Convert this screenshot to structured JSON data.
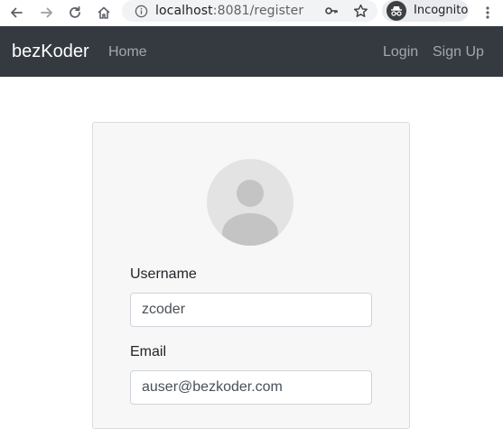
{
  "browser": {
    "url_host": "localhost",
    "url_port_path": ":8081/register",
    "incognito_label": "Incognito"
  },
  "navbar": {
    "brand": "bezKoder",
    "home_label": "Home",
    "login_label": "Login",
    "signup_label": "Sign Up"
  },
  "form": {
    "username_label": "Username",
    "username_value": "zcoder",
    "email_label": "Email",
    "email_value": "auser@bezkoder.com"
  },
  "colors": {
    "navbar_bg": "#343a40",
    "card_bg": "#f7f7f7",
    "avatar_bg": "#e3e3e3",
    "avatar_fg": "#c4c4c4"
  },
  "icons": {
    "back": "arrow-left-icon",
    "forward": "arrow-right-icon",
    "reload": "reload-icon",
    "home": "home-icon",
    "info": "info-icon",
    "key": "key-icon",
    "star": "star-icon",
    "incognito": "incognito-icon",
    "menu": "more-vert-icon",
    "avatar": "user-avatar-icon"
  }
}
